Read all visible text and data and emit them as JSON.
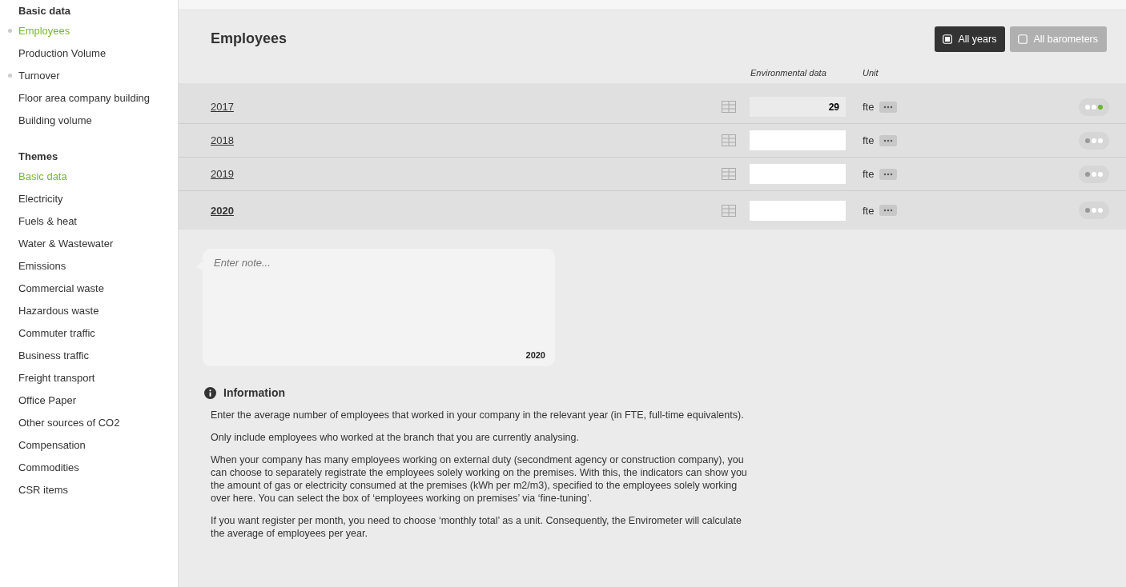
{
  "sidebar": {
    "sections": [
      {
        "title": "Basic data",
        "items": [
          {
            "label": "Employees",
            "selected": true,
            "dotted": true
          },
          {
            "label": "Production Volume",
            "selected": false,
            "dotted": false
          },
          {
            "label": "Turnover",
            "selected": false,
            "dotted": true
          },
          {
            "label": "Floor area company building",
            "selected": false,
            "dotted": false
          },
          {
            "label": "Building volume",
            "selected": false,
            "dotted": false
          }
        ]
      },
      {
        "title": "Themes",
        "items": [
          {
            "label": "Basic data",
            "selected": true,
            "dotted": false
          },
          {
            "label": "Electricity",
            "selected": false,
            "dotted": false
          },
          {
            "label": "Fuels & heat",
            "selected": false,
            "dotted": false
          },
          {
            "label": "Water & Wastewater",
            "selected": false,
            "dotted": false
          },
          {
            "label": "Emissions",
            "selected": false,
            "dotted": false
          },
          {
            "label": "Commercial waste",
            "selected": false,
            "dotted": false
          },
          {
            "label": "Hazardous waste",
            "selected": false,
            "dotted": false
          },
          {
            "label": "Commuter traffic",
            "selected": false,
            "dotted": false
          },
          {
            "label": "Business traffic",
            "selected": false,
            "dotted": false
          },
          {
            "label": "Freight transport",
            "selected": false,
            "dotted": false
          },
          {
            "label": "Office Paper",
            "selected": false,
            "dotted": false
          },
          {
            "label": "Other sources of CO2",
            "selected": false,
            "dotted": false
          },
          {
            "label": "Compensation",
            "selected": false,
            "dotted": false
          },
          {
            "label": "Commodities",
            "selected": false,
            "dotted": false
          },
          {
            "label": "CSR items",
            "selected": false,
            "dotted": false
          }
        ]
      }
    ]
  },
  "page": {
    "title": "Employees",
    "toggles": [
      {
        "label": "All years",
        "checked": true
      },
      {
        "label": "All barometers",
        "checked": false
      }
    ],
    "columns": [
      "Environmental data",
      "Unit"
    ],
    "rows": [
      {
        "year": "2017",
        "value": "29",
        "unit": "fte",
        "selected": false,
        "complete": true
      },
      {
        "year": "2018",
        "value": "",
        "unit": "fte",
        "selected": false,
        "complete": false
      },
      {
        "year": "2019",
        "value": "",
        "unit": "fte",
        "selected": false,
        "complete": false
      },
      {
        "year": "2020",
        "value": "",
        "unit": "fte",
        "selected": true,
        "complete": false
      }
    ],
    "note": {
      "placeholder": "Enter note...",
      "year": "2020"
    },
    "information": {
      "title": "Information",
      "paragraphs": [
        "Enter the average number of employees that worked in your company in the relevant year (in FTE, full-time equivalents).",
        "Only include employees who worked at the branch that you are currently analysing.",
        "When your company has many employees working on external duty (secondment agency or construction company), you can choose to separately registrate the employees solely working on the premises. With this, the indicators can show you the amount of gas or electricity consumed at the premises (kWh per m2/m3), specified to the employees solely working over here. You can select the box of ‘employees working on premises’ via ‘fine-tuning’.",
        "If you want register per month, you need to choose ‘monthly total’ as a unit. Consequently, the Envirometer will calculate the average of employees per year."
      ]
    }
  }
}
